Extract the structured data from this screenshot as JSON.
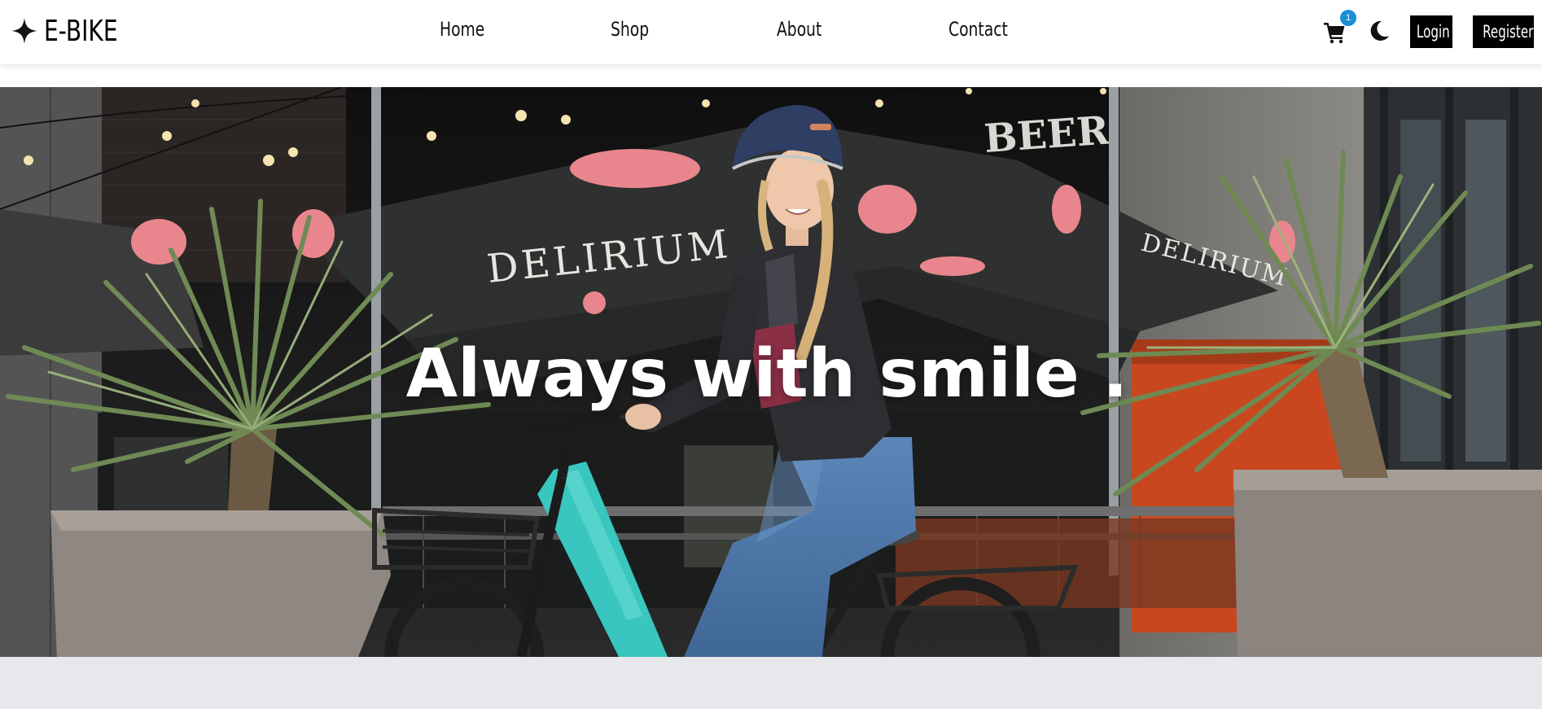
{
  "brand": {
    "name": "E-BIKE",
    "icon": "four-point-star-icon"
  },
  "nav": {
    "links": [
      {
        "label": "Home"
      },
      {
        "label": "Shop"
      },
      {
        "label": "About"
      },
      {
        "label": "Contact"
      }
    ]
  },
  "actions": {
    "cart_icon": "cart-icon",
    "cart_count": "1",
    "theme_icon": "moon-icon",
    "login_label": "Login",
    "register_label": "Register"
  },
  "hero": {
    "headline": "Always with smile ."
  },
  "colors": {
    "accent_badge": "#1a8fd6",
    "button_bg": "#000000",
    "below_hero_bg": "#e7e8ec"
  }
}
